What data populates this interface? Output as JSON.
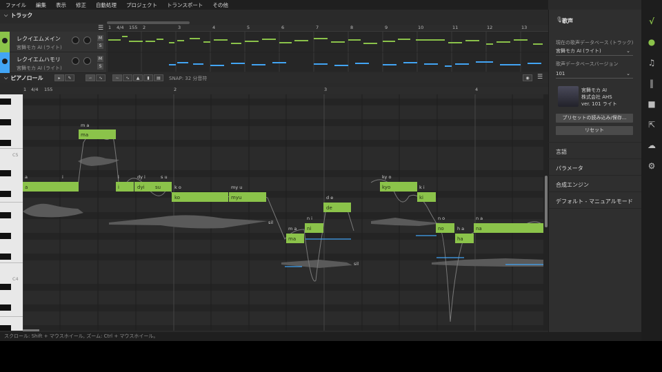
{
  "menu": [
    "ファイル",
    "編集",
    "表示",
    "修正",
    "自動処理",
    "プロジェクト",
    "トランスポート",
    "その他"
  ],
  "track_section": {
    "title": "トラック"
  },
  "tracks": [
    {
      "name": "レクイエムメイン",
      "voice": "宮舞モカ AI (ライト)",
      "mute": "M",
      "solo": "S",
      "color": "#8bc34a"
    },
    {
      "name": "レクイエムハモリ",
      "voice": "宮舞モカ AI (ライト)",
      "mute": "M",
      "solo": "S",
      "color": "#42a5f5"
    }
  ],
  "track_ruler": {
    "start": "1",
    "signature": "4/4",
    "tempo": "155",
    "bars": [
      "2",
      "3",
      "4",
      "5",
      "6",
      "7",
      "8",
      "9",
      "10",
      "11",
      "12",
      "13"
    ]
  },
  "piano_roll": {
    "title": "ピアノロール",
    "snap": "SNAP: 32 分音符",
    "ruler": {
      "signature": "4/4",
      "tempo": "155",
      "bars": [
        "1",
        "2",
        "3",
        "4"
      ]
    },
    "key_labels": [
      "C5",
      "C4"
    ],
    "notes": [
      {
        "lyric": "ma",
        "phoneme": "m a"
      },
      {
        "lyric": "a",
        "phoneme": "a"
      },
      {
        "lyric": "i",
        "phoneme": "i"
      },
      {
        "lyric": "i",
        "phoneme": "i"
      },
      {
        "lyric": "dyi",
        "phoneme": "dy i"
      },
      {
        "lyric": "su",
        "phoneme": "s u"
      },
      {
        "lyric": "ko",
        "phoneme": "k o"
      },
      {
        "lyric": "myu",
        "phoneme": "my u"
      },
      {
        "lyric": "ma",
        "phoneme": "m a"
      },
      {
        "lyric": "ni",
        "phoneme": "n i"
      },
      {
        "lyric": "de",
        "phoneme": "d e"
      },
      {
        "lyric": "kyo",
        "phoneme": "ky o"
      },
      {
        "lyric": "ki",
        "phoneme": "k i"
      },
      {
        "lyric": "no",
        "phoneme": "n o"
      },
      {
        "lyric": "ha",
        "phoneme": "h a"
      },
      {
        "lyric": "na",
        "phoneme": "n a"
      }
    ],
    "phoneme_sil": "sil"
  },
  "status": "スクロール: Shift + マウスホイール, ズーム: Ctrl + マウスホイール。",
  "right_panel": {
    "title": "歌声",
    "db_label": "現在の歌声データベース (トラック)",
    "db_value": "宮舞モカ AI (ライト)",
    "version_label": "歌声データベースバージョン",
    "version_value": "101",
    "voice_name": "宮舞モカ AI",
    "voice_company": "株式会社 AHS",
    "voice_version": "ver. 101 ライト",
    "preset_button": "プリセットの読み込み/保存...",
    "reset_button": "リセット",
    "sections": [
      "言語",
      "パラメータ",
      "合成エンジン",
      "デフォルト - マニュアルモード"
    ]
  },
  "colors": {
    "note_main": "#8bc34a",
    "note_harmony": "#42a5f5",
    "background": "#2a2a2a"
  },
  "sidebar_icons": [
    "logo-icon",
    "mic-icon",
    "music-note-icon",
    "library-icon",
    "book-icon",
    "export-icon",
    "cloud-icon",
    "gear-icon"
  ]
}
